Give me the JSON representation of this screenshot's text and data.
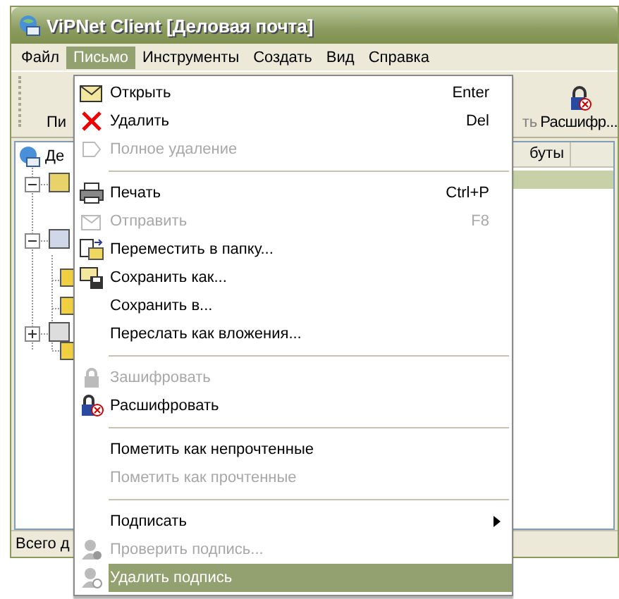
{
  "window": {
    "title": "ViPNet Client [Деловая почта]"
  },
  "menu_bar": [
    {
      "label": "Файл",
      "selected": false
    },
    {
      "label": "Письмо",
      "selected": true
    },
    {
      "label": "Инструменты",
      "selected": false
    },
    {
      "label": "Создать",
      "selected": false
    },
    {
      "label": "Вид",
      "selected": false
    },
    {
      "label": "Справка",
      "selected": false
    }
  ],
  "toolbar": [
    {
      "label": "Пи",
      "disabled": false
    },
    {
      "label": "ть",
      "disabled": true
    },
    {
      "label": "Расшифр...",
      "disabled": false
    }
  ],
  "tree": {
    "root": "Де"
  },
  "list_header": {
    "column_1": "буты"
  },
  "status_bar": "Всего д",
  "dropdown": [
    {
      "kind": "item",
      "label": "Открыть",
      "shortcut": "Enter",
      "disabled": false,
      "selected": false,
      "submenu": false
    },
    {
      "kind": "item",
      "label": "Удалить",
      "shortcut": "Del",
      "disabled": false,
      "selected": false,
      "submenu": false
    },
    {
      "kind": "item",
      "label": "Полное удаление",
      "disabled": true,
      "selected": false,
      "submenu": false
    },
    {
      "kind": "separator"
    },
    {
      "kind": "item",
      "label": "Печать",
      "shortcut": "Ctrl+P",
      "disabled": false,
      "selected": false,
      "submenu": false
    },
    {
      "kind": "item",
      "label": "Отправить",
      "shortcut": "F8",
      "disabled": true,
      "selected": false,
      "submenu": false
    },
    {
      "kind": "item",
      "label": "Переместить в папку...",
      "disabled": false,
      "selected": false,
      "submenu": false
    },
    {
      "kind": "item",
      "label": "Сохранить как...",
      "disabled": false,
      "selected": false,
      "submenu": false
    },
    {
      "kind": "item",
      "label": "Сохранить в...",
      "disabled": false,
      "selected": false,
      "submenu": false
    },
    {
      "kind": "item",
      "label": "Переслать как вложения...",
      "disabled": false,
      "selected": false,
      "submenu": false
    },
    {
      "kind": "separator"
    },
    {
      "kind": "item",
      "label": "Зашифровать",
      "disabled": true,
      "selected": false,
      "submenu": false
    },
    {
      "kind": "item",
      "label": "Расшифровать",
      "disabled": false,
      "selected": false,
      "submenu": false
    },
    {
      "kind": "separator"
    },
    {
      "kind": "item",
      "label": "Пометить как непрочтенные",
      "disabled": false,
      "selected": false,
      "submenu": false
    },
    {
      "kind": "item",
      "label": "Пометить как прочтенные",
      "disabled": true,
      "selected": false,
      "submenu": false
    },
    {
      "kind": "separator"
    },
    {
      "kind": "item",
      "label": "Подписать",
      "disabled": false,
      "selected": false,
      "submenu": true
    },
    {
      "kind": "item",
      "label": "Проверить подпись...",
      "disabled": true,
      "selected": false,
      "submenu": false
    },
    {
      "kind": "item",
      "label": "Удалить подпись",
      "disabled": false,
      "selected": true,
      "submenu": false
    }
  ]
}
